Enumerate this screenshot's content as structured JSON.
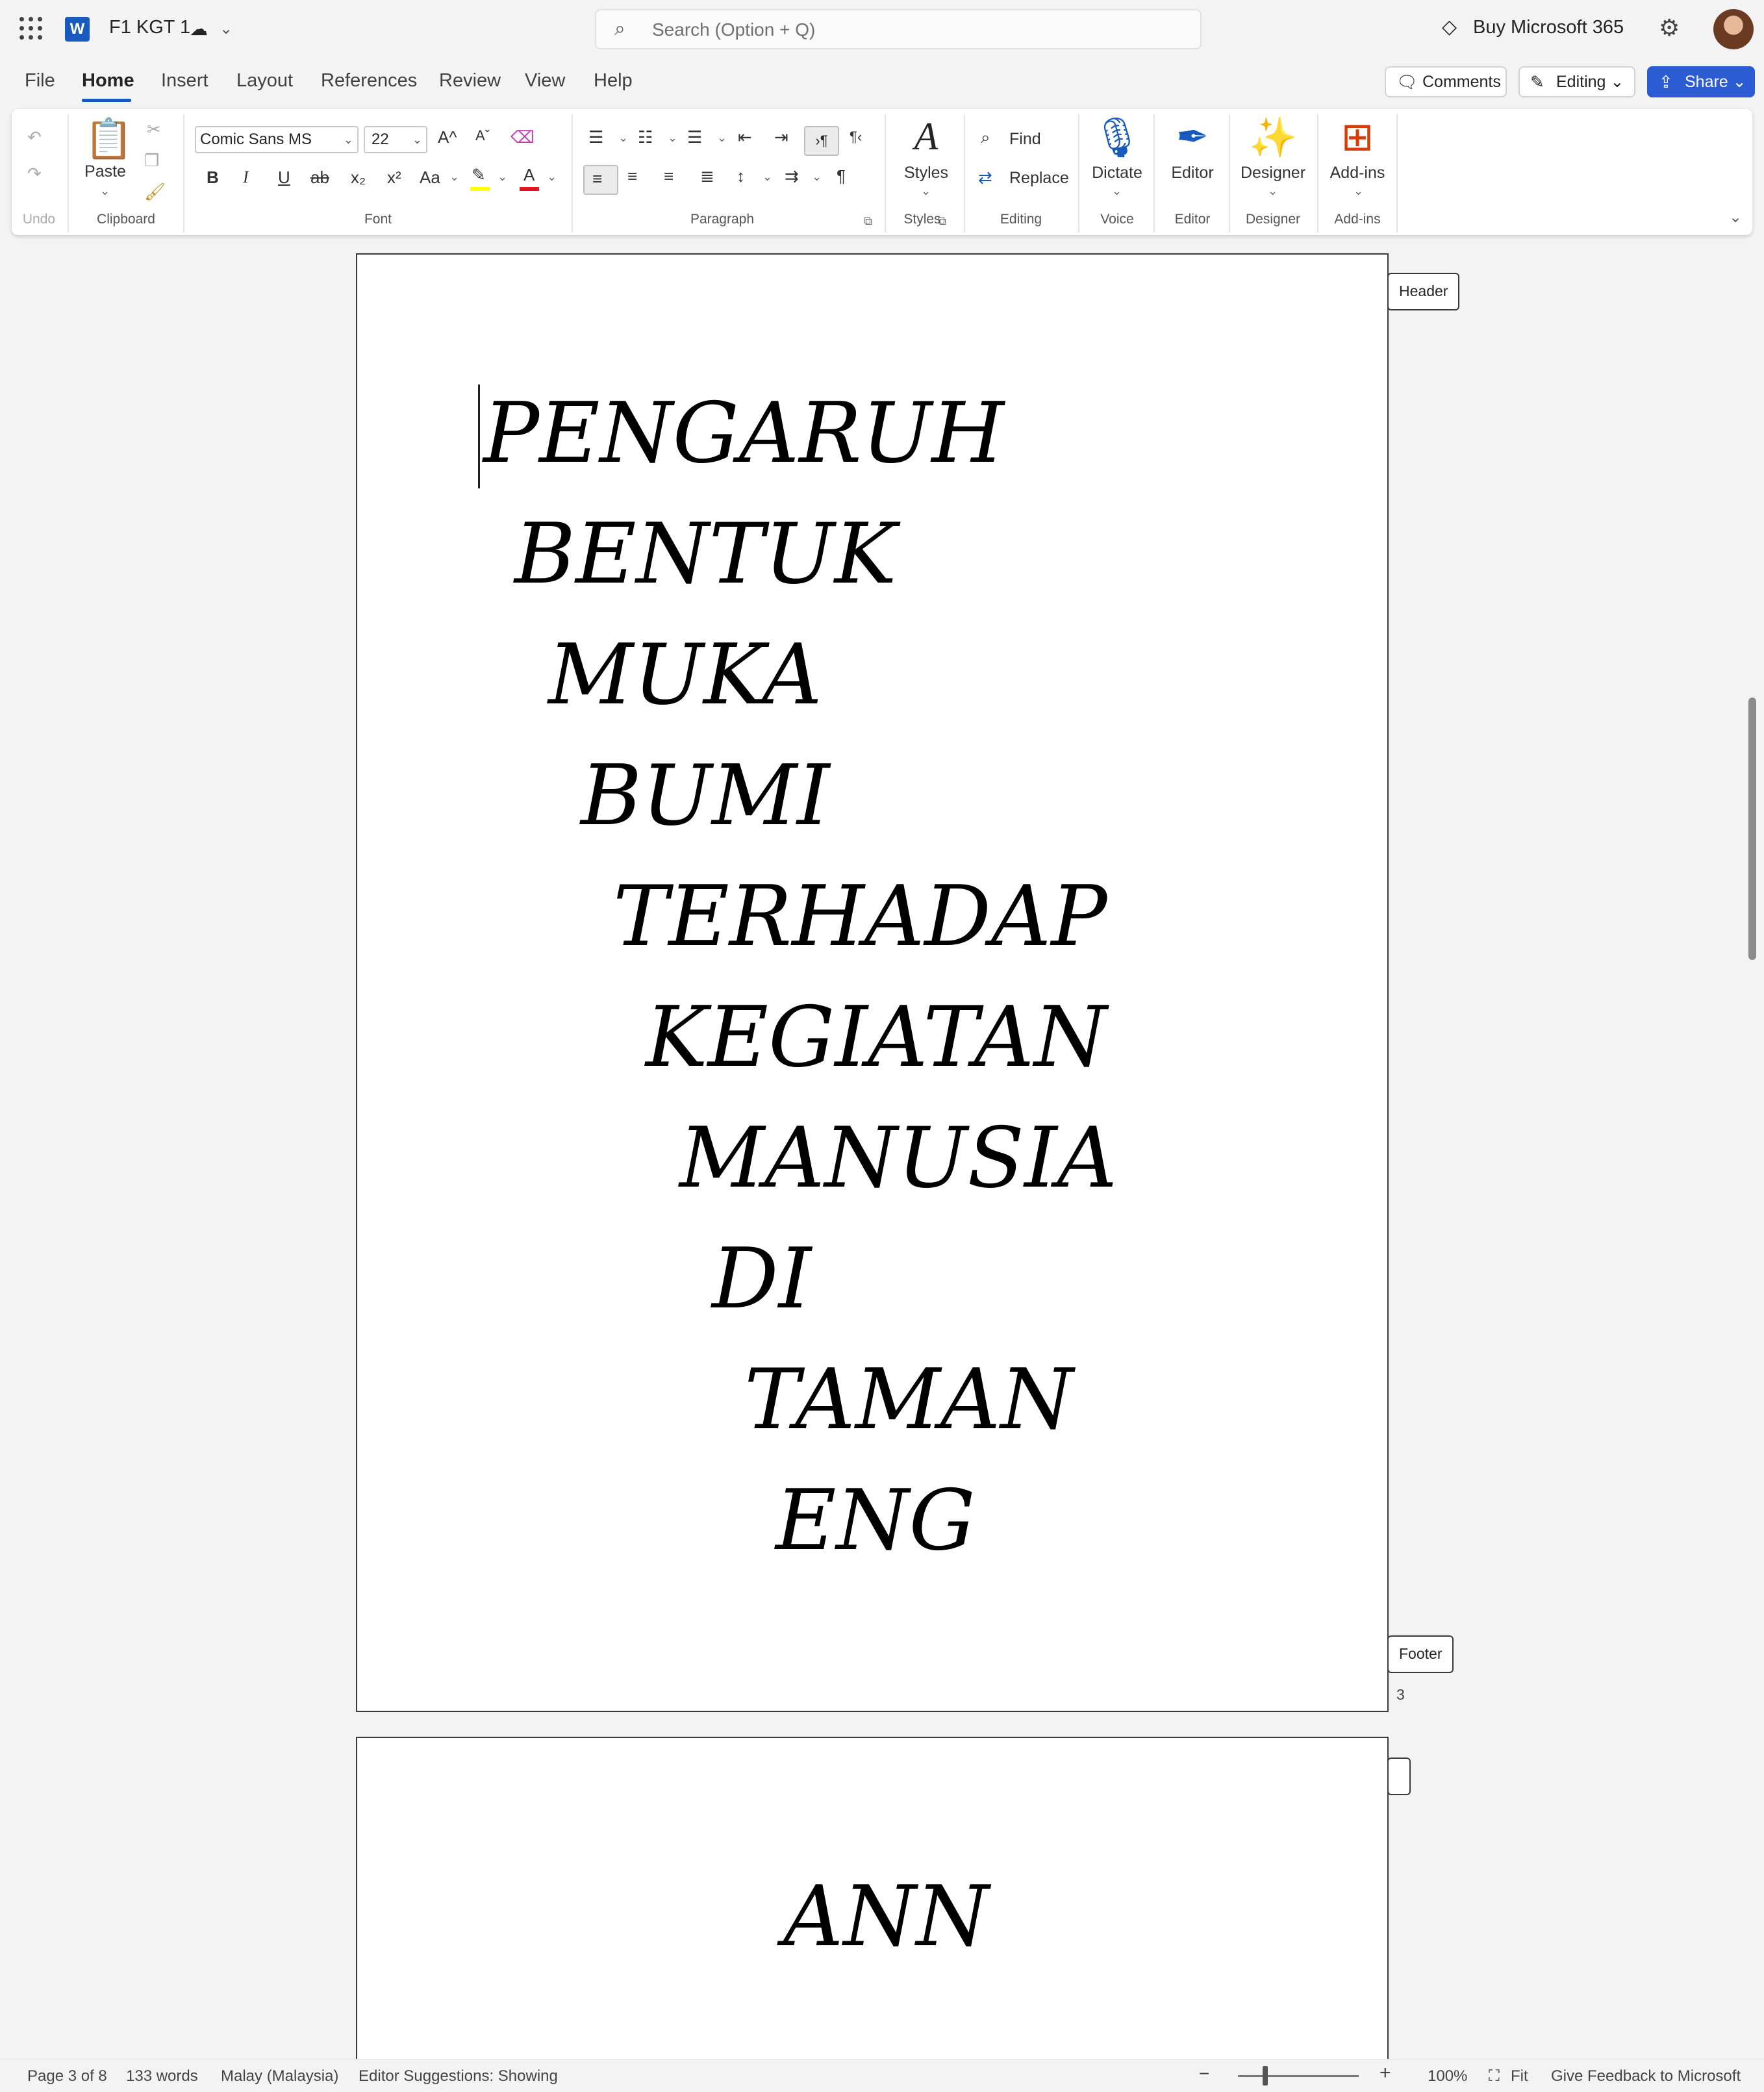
{
  "titlebar": {
    "doc_title": "F1 KGT 1",
    "search_placeholder": "Search (Option + Q)",
    "buy_label": "Buy Microsoft 365"
  },
  "menu": {
    "tabs": [
      "File",
      "Home",
      "Insert",
      "Layout",
      "References",
      "Review",
      "View",
      "Help"
    ],
    "active_tab": "Home",
    "comments_label": "Comments",
    "editing_label": "Editing",
    "share_label": "Share"
  },
  "ribbon": {
    "font_name": "Comic Sans MS",
    "font_size": "22",
    "paste_label": "Paste",
    "styles_label": "Styles",
    "find_label": "Find",
    "replace_label": "Replace",
    "dictate_label": "Dictate",
    "editor_label": "Editor",
    "designer_label": "Designer",
    "addins_label": "Add-ins",
    "groups": {
      "undo": "Undo",
      "clipboard": "Clipboard",
      "font": "Font",
      "paragraph": "Paragraph",
      "styles": "Styles",
      "editing": "Editing",
      "voice": "Voice",
      "editor": "Editor",
      "designer": "Designer",
      "addins": "Add-ins"
    },
    "font_buttons": {
      "bold": "B",
      "italic": "I",
      "underline": "U",
      "strike": "ab",
      "subscript": "x₂",
      "superscript": "x²",
      "change_case": "Aa",
      "grow": "A^",
      "shrink": "Aˇ"
    }
  },
  "document": {
    "page1_lines": [
      "PENGARUH",
      "BENTUK",
      "MUKA",
      "BUMI",
      "TERHADAP",
      "KEGIATAN",
      "MANUSIA",
      "DI",
      "TAMAN",
      "ENG"
    ],
    "page2_lines": [
      "ANN"
    ],
    "header_tag": "Header",
    "footer_tag": "Footer",
    "page_number": "3"
  },
  "status": {
    "page": "Page 3 of 8",
    "words": "133 words",
    "language": "Malay (Malaysia)",
    "editor_suggestions": "Editor Suggestions: Showing",
    "zoom": "100%",
    "fit": "Fit",
    "feedback": "Give Feedback to Microsoft",
    "zoom_level_percent": 100
  },
  "colors": {
    "accent": "#185abd",
    "share_button": "#2b5cd1",
    "highlight_yellow": "#ffff00",
    "font_color_red": "#e81123",
    "addins_red": "#d83b01"
  }
}
